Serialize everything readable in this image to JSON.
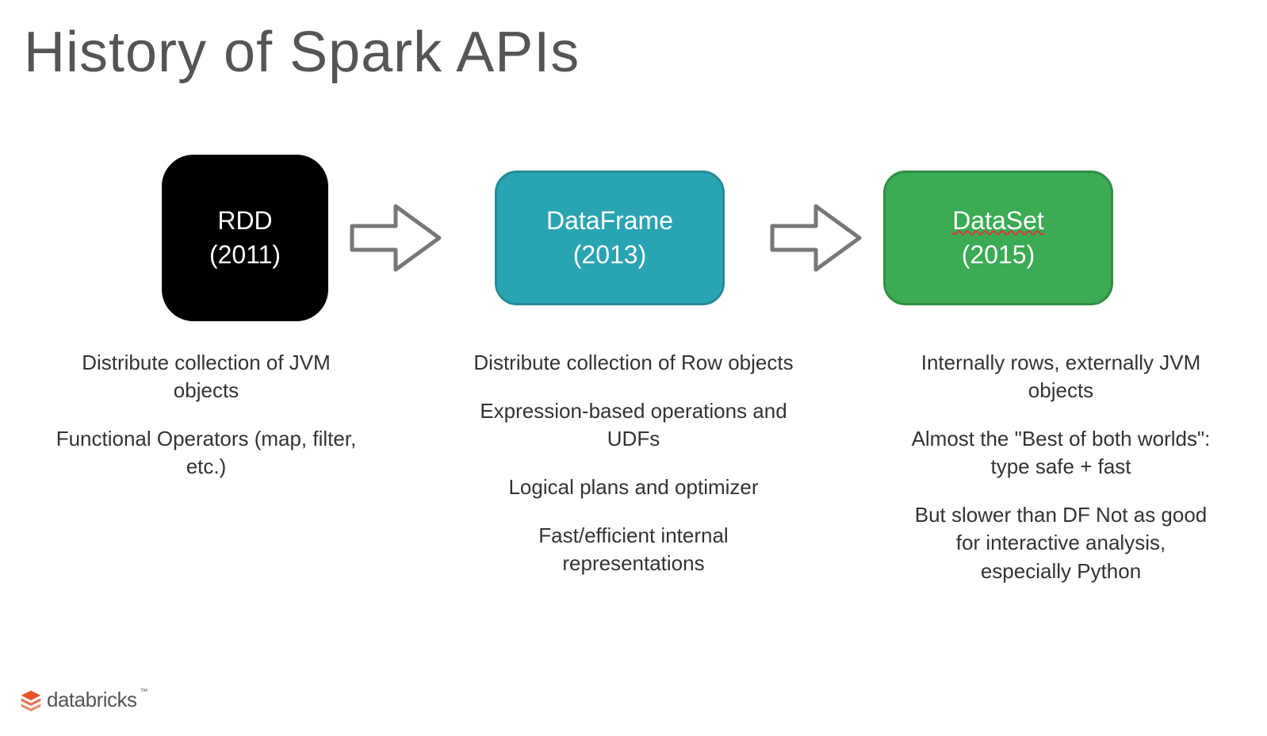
{
  "title": "History of Spark APIs",
  "nodes": {
    "rdd": {
      "name": "RDD",
      "year": "(2011)",
      "color": "#000000"
    },
    "dataframe": {
      "name": "DataFrame",
      "year": "(2013)",
      "color": "#2aa4b2"
    },
    "dataset": {
      "name": "DataSet",
      "year": "(2015)",
      "color": "#3bab54"
    }
  },
  "descriptions": {
    "rdd": [
      "Distribute collection of JVM objects",
      "Functional Operators (map, filter, etc.)"
    ],
    "dataframe": [
      "Distribute collection of Row objects",
      "Expression-based operations and UDFs",
      "Logical plans and optimizer",
      "Fast/efficient internal representations"
    ],
    "dataset": [
      "Internally rows, externally JVM objects",
      "Almost the \"Best of both worlds\": type safe + fast",
      "But slower than DF Not as good for interactive analysis, especially Python"
    ]
  },
  "logo": {
    "text": "databricks",
    "tm": "™"
  }
}
